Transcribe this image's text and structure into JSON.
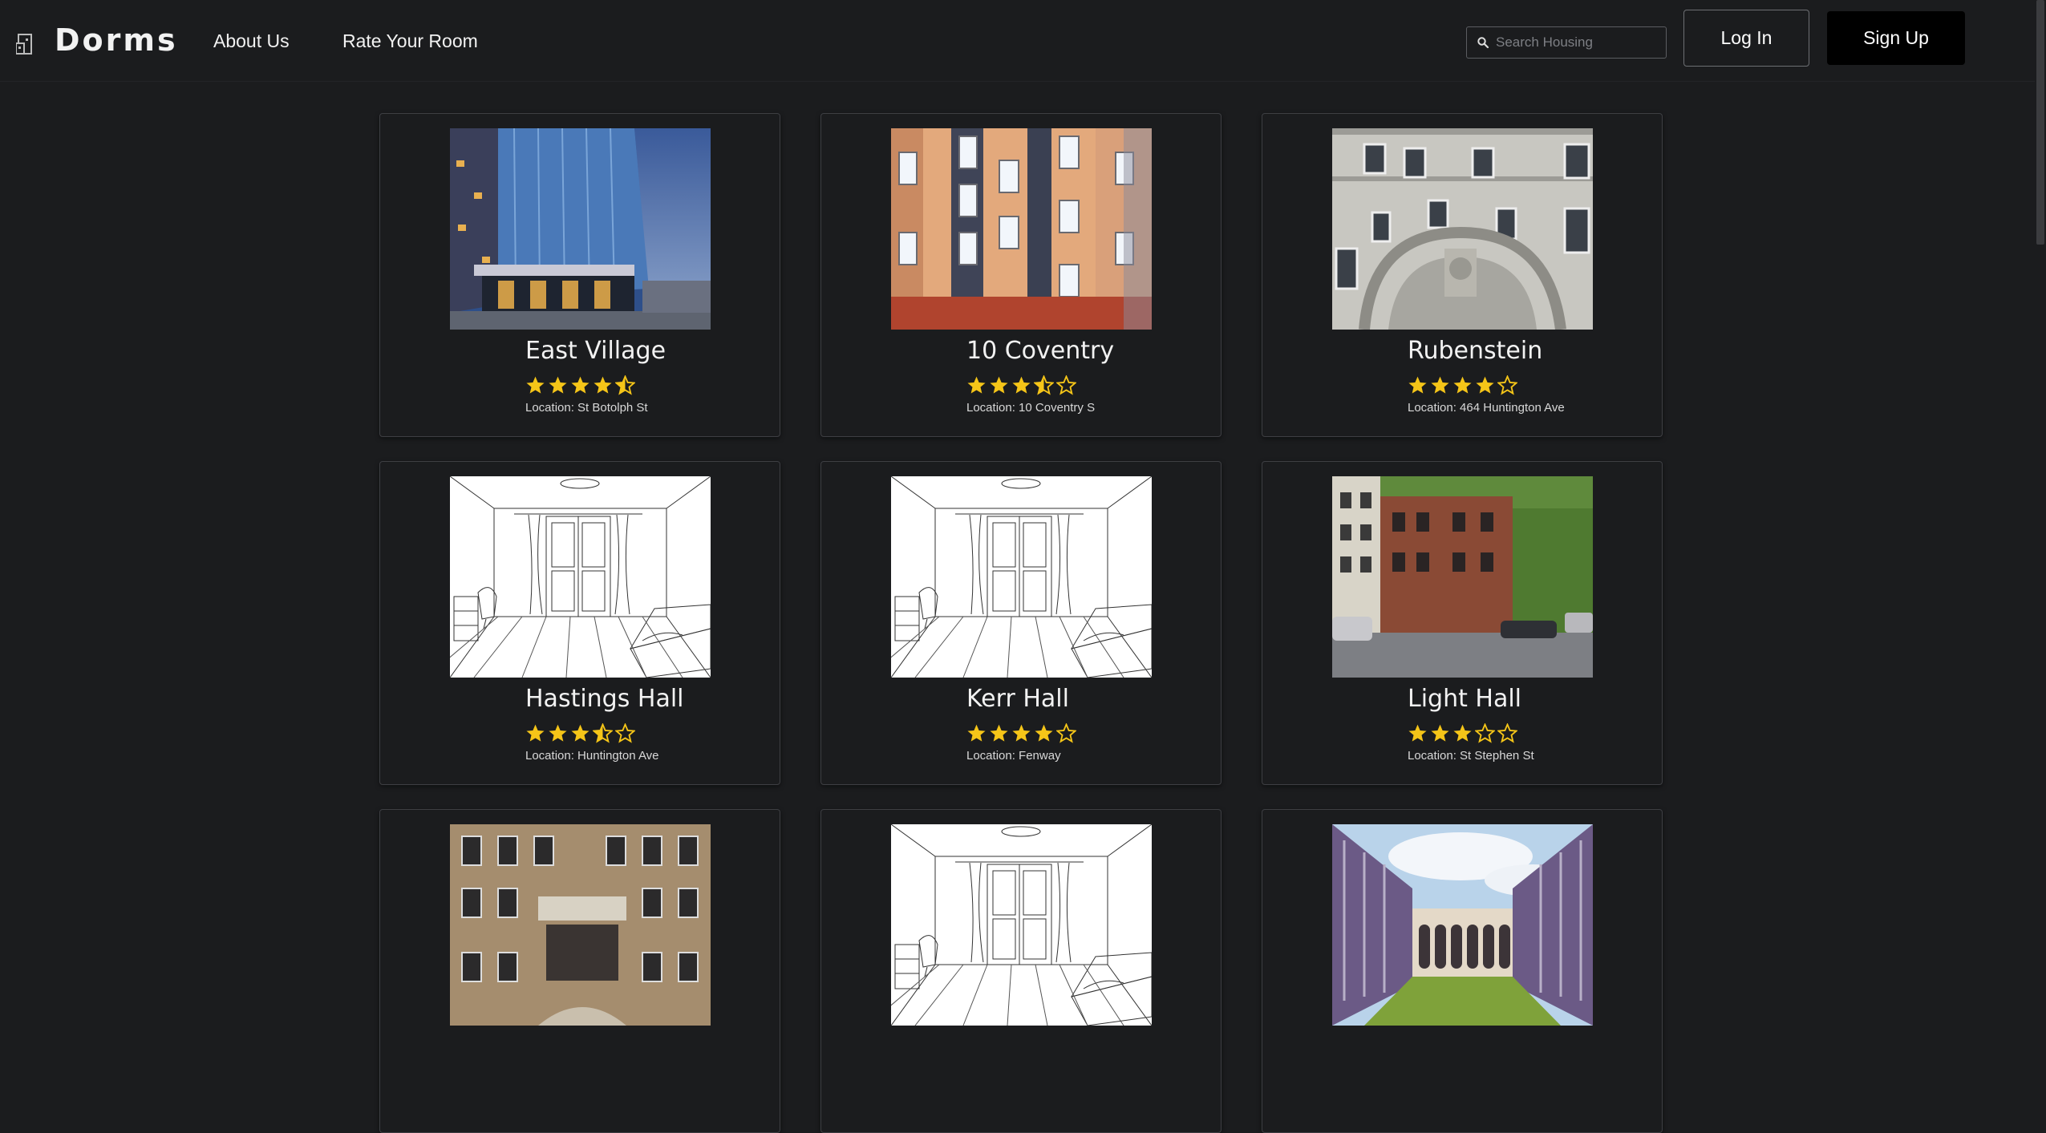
{
  "header": {
    "logo_text": "Dorms",
    "nav": {
      "about": "About Us",
      "rate": "Rate Your Room"
    },
    "search_placeholder": "Search Housing",
    "login_label": "Log In",
    "signup_label": "Sign Up"
  },
  "star_color": "#f5c518",
  "cards": [
    {
      "title": "East Village",
      "rating": 4.5,
      "location": "Location: St Botolph St",
      "image": "glass-tower-photo"
    },
    {
      "title": "10 Coventry",
      "rating": 3.5,
      "location": "Location: 10 Coventry S",
      "image": "brick-facade-photo"
    },
    {
      "title": "Rubenstein",
      "rating": 4,
      "location": "Location: 464 Huntington Ave",
      "image": "stone-arch-photo"
    },
    {
      "title": "Hastings Hall",
      "rating": 3.5,
      "location": "Location: Huntington Ave",
      "image": "room-sketch"
    },
    {
      "title": "Kerr Hall",
      "rating": 4,
      "location": "Location: Fenway",
      "image": "room-sketch"
    },
    {
      "title": "Light Hall",
      "rating": 3,
      "location": "Location: St Stephen St",
      "image": "brownstone-street-photo"
    },
    {
      "title": "",
      "rating": 0,
      "location": "",
      "image": "tan-brick-building-photo"
    },
    {
      "title": "",
      "rating": 0,
      "location": "",
      "image": "room-sketch"
    },
    {
      "title": "",
      "rating": 0,
      "location": "",
      "image": "courtyard-lawn-photo"
    }
  ]
}
